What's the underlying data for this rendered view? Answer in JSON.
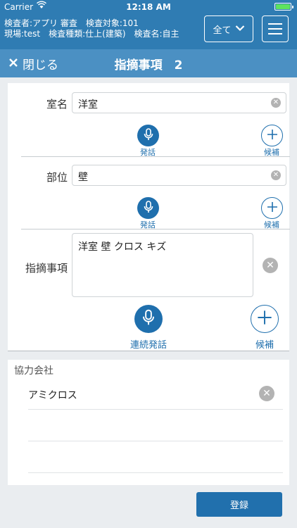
{
  "status_bar": {
    "carrier": "Carrier",
    "time": "12:18 AM"
  },
  "header": {
    "info_line1": "検査者:アプリ 審査　検査対象:101",
    "info_line2": "現場:test　検査種類:仕上(建築)　検査名:自主",
    "filter_label": "全て"
  },
  "navbar": {
    "close_label": "閉じる",
    "title": "指摘事項　2"
  },
  "form": {
    "room": {
      "label": "室名",
      "value": "洋室"
    },
    "part": {
      "label": "部位",
      "value": "壁"
    },
    "issue": {
      "label": "指摘事項",
      "value": "洋室 壁 クロス キズ"
    },
    "speak_label": "発話",
    "candidate_label": "候補",
    "continuous_speak_label": "連続発話"
  },
  "partner": {
    "section_title": "協力会社",
    "value": "アミクロス"
  },
  "footer": {
    "register_label": "登録"
  },
  "colors": {
    "header_blue": "#2f7cb3",
    "nav_blue": "#4b90c3",
    "accent": "#1f6fad"
  }
}
